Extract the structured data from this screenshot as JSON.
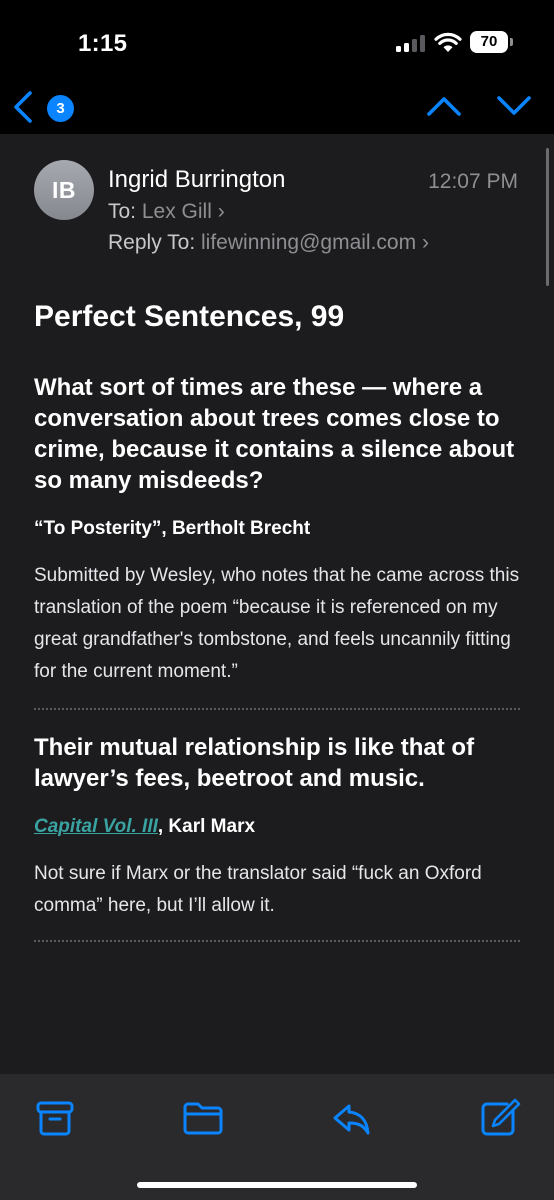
{
  "status_bar": {
    "time": "1:15",
    "battery_level": "70",
    "signal_icon": "cellular-signal-icon",
    "wifi_icon": "wifi-icon"
  },
  "nav": {
    "unread_count": "3",
    "accent_color": "#0a84ff"
  },
  "email": {
    "avatar_initials": "IB",
    "sender": "Ingrid Burrington",
    "time": "12:07 PM",
    "to_label": "To:",
    "to_value": "Lex Gill",
    "reply_label": "Reply To:",
    "reply_value": "lifewinning@gmail.com",
    "subject": "Perfect Sentences, 99",
    "entries": [
      {
        "quote": "What sort of times are these — where a conversation about trees comes close to crime, because it contains a silence about so many misdeeds?",
        "attribution": "“To Posterity”, Bertholt Brecht",
        "note": "Submitted by Wesley, who notes that he came across this translation of the poem “because it is referenced on my great grandfather's tombstone, and feels uncannily fitting for the current moment.”"
      },
      {
        "quote": "Their mutual relationship is like that of lawyer’s fees, beetroot and music.",
        "attribution_link": "Capital Vol. III",
        "attribution_rest": ", Karl Marx",
        "note": "Not sure if Marx or the translator said “fuck an Oxford comma” here, but I’ll allow it."
      }
    ]
  },
  "toolbar": {
    "icons": [
      "archive-icon",
      "folder-icon",
      "reply-icon",
      "compose-icon"
    ]
  }
}
